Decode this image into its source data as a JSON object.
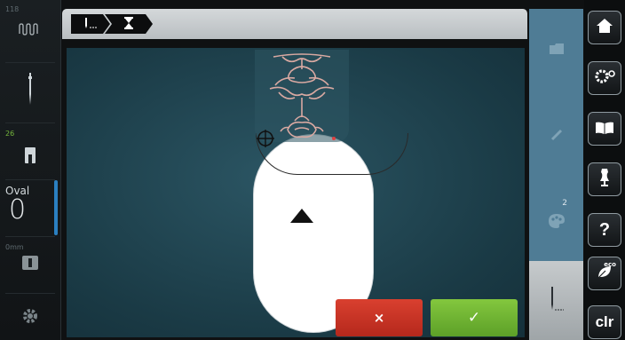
{
  "status_bar": {
    "top_number": "118",
    "thread_count": "26",
    "hoop_label": "Oval",
    "hoop_value": "0",
    "needle_label": "0mm"
  },
  "path_bar": {
    "crumbs": [
      {
        "icon": "needle-stitch-icon"
      },
      {
        "icon": "hourglass-icon"
      }
    ]
  },
  "tool_column": {
    "slots": [
      {
        "icon": "folder-icon",
        "badge": ""
      },
      {
        "icon": "pencil-icon",
        "badge": ""
      },
      {
        "icon": "palette-icon",
        "badge": "2"
      },
      {
        "icon": "needle-edit-icon",
        "badge": ""
      }
    ],
    "active_index": 3
  },
  "function_buttons": {
    "home": "home-icon",
    "setup": "gear-icon",
    "tutorial": "book-icon",
    "consultant": "dress-form-icon",
    "help": "?",
    "eco": "eco",
    "clear": "clr"
  },
  "actions": {
    "cancel_label": "×",
    "confirm_label": "✓"
  },
  "colors": {
    "canvas": "#1a3a45",
    "tool_column": "#4f7c95",
    "cancel": "#c73424",
    "confirm": "#72b535",
    "ornament": "#d9a9a2"
  }
}
